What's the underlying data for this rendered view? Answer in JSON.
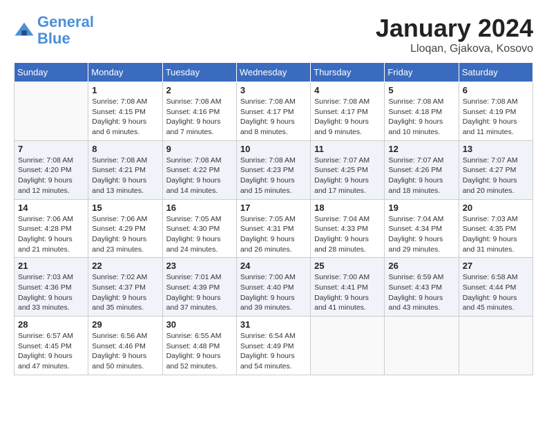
{
  "header": {
    "logo_line1": "General",
    "logo_line2": "Blue",
    "month_year": "January 2024",
    "location": "Lloqan, Gjakova, Kosovo"
  },
  "days_of_week": [
    "Sunday",
    "Monday",
    "Tuesday",
    "Wednesday",
    "Thursday",
    "Friday",
    "Saturday"
  ],
  "weeks": [
    [
      {
        "day": "",
        "sunrise": "",
        "sunset": "",
        "daylight": ""
      },
      {
        "day": "1",
        "sunrise": "Sunrise: 7:08 AM",
        "sunset": "Sunset: 4:15 PM",
        "daylight": "Daylight: 9 hours and 6 minutes."
      },
      {
        "day": "2",
        "sunrise": "Sunrise: 7:08 AM",
        "sunset": "Sunset: 4:16 PM",
        "daylight": "Daylight: 9 hours and 7 minutes."
      },
      {
        "day": "3",
        "sunrise": "Sunrise: 7:08 AM",
        "sunset": "Sunset: 4:17 PM",
        "daylight": "Daylight: 9 hours and 8 minutes."
      },
      {
        "day": "4",
        "sunrise": "Sunrise: 7:08 AM",
        "sunset": "Sunset: 4:17 PM",
        "daylight": "Daylight: 9 hours and 9 minutes."
      },
      {
        "day": "5",
        "sunrise": "Sunrise: 7:08 AM",
        "sunset": "Sunset: 4:18 PM",
        "daylight": "Daylight: 9 hours and 10 minutes."
      },
      {
        "day": "6",
        "sunrise": "Sunrise: 7:08 AM",
        "sunset": "Sunset: 4:19 PM",
        "daylight": "Daylight: 9 hours and 11 minutes."
      }
    ],
    [
      {
        "day": "7",
        "sunrise": "Sunrise: 7:08 AM",
        "sunset": "Sunset: 4:20 PM",
        "daylight": "Daylight: 9 hours and 12 minutes."
      },
      {
        "day": "8",
        "sunrise": "Sunrise: 7:08 AM",
        "sunset": "Sunset: 4:21 PM",
        "daylight": "Daylight: 9 hours and 13 minutes."
      },
      {
        "day": "9",
        "sunrise": "Sunrise: 7:08 AM",
        "sunset": "Sunset: 4:22 PM",
        "daylight": "Daylight: 9 hours and 14 minutes."
      },
      {
        "day": "10",
        "sunrise": "Sunrise: 7:08 AM",
        "sunset": "Sunset: 4:23 PM",
        "daylight": "Daylight: 9 hours and 15 minutes."
      },
      {
        "day": "11",
        "sunrise": "Sunrise: 7:07 AM",
        "sunset": "Sunset: 4:25 PM",
        "daylight": "Daylight: 9 hours and 17 minutes."
      },
      {
        "day": "12",
        "sunrise": "Sunrise: 7:07 AM",
        "sunset": "Sunset: 4:26 PM",
        "daylight": "Daylight: 9 hours and 18 minutes."
      },
      {
        "day": "13",
        "sunrise": "Sunrise: 7:07 AM",
        "sunset": "Sunset: 4:27 PM",
        "daylight": "Daylight: 9 hours and 20 minutes."
      }
    ],
    [
      {
        "day": "14",
        "sunrise": "Sunrise: 7:06 AM",
        "sunset": "Sunset: 4:28 PM",
        "daylight": "Daylight: 9 hours and 21 minutes."
      },
      {
        "day": "15",
        "sunrise": "Sunrise: 7:06 AM",
        "sunset": "Sunset: 4:29 PM",
        "daylight": "Daylight: 9 hours and 23 minutes."
      },
      {
        "day": "16",
        "sunrise": "Sunrise: 7:05 AM",
        "sunset": "Sunset: 4:30 PM",
        "daylight": "Daylight: 9 hours and 24 minutes."
      },
      {
        "day": "17",
        "sunrise": "Sunrise: 7:05 AM",
        "sunset": "Sunset: 4:31 PM",
        "daylight": "Daylight: 9 hours and 26 minutes."
      },
      {
        "day": "18",
        "sunrise": "Sunrise: 7:04 AM",
        "sunset": "Sunset: 4:33 PM",
        "daylight": "Daylight: 9 hours and 28 minutes."
      },
      {
        "day": "19",
        "sunrise": "Sunrise: 7:04 AM",
        "sunset": "Sunset: 4:34 PM",
        "daylight": "Daylight: 9 hours and 29 minutes."
      },
      {
        "day": "20",
        "sunrise": "Sunrise: 7:03 AM",
        "sunset": "Sunset: 4:35 PM",
        "daylight": "Daylight: 9 hours and 31 minutes."
      }
    ],
    [
      {
        "day": "21",
        "sunrise": "Sunrise: 7:03 AM",
        "sunset": "Sunset: 4:36 PM",
        "daylight": "Daylight: 9 hours and 33 minutes."
      },
      {
        "day": "22",
        "sunrise": "Sunrise: 7:02 AM",
        "sunset": "Sunset: 4:37 PM",
        "daylight": "Daylight: 9 hours and 35 minutes."
      },
      {
        "day": "23",
        "sunrise": "Sunrise: 7:01 AM",
        "sunset": "Sunset: 4:39 PM",
        "daylight": "Daylight: 9 hours and 37 minutes."
      },
      {
        "day": "24",
        "sunrise": "Sunrise: 7:00 AM",
        "sunset": "Sunset: 4:40 PM",
        "daylight": "Daylight: 9 hours and 39 minutes."
      },
      {
        "day": "25",
        "sunrise": "Sunrise: 7:00 AM",
        "sunset": "Sunset: 4:41 PM",
        "daylight": "Daylight: 9 hours and 41 minutes."
      },
      {
        "day": "26",
        "sunrise": "Sunrise: 6:59 AM",
        "sunset": "Sunset: 4:43 PM",
        "daylight": "Daylight: 9 hours and 43 minutes."
      },
      {
        "day": "27",
        "sunrise": "Sunrise: 6:58 AM",
        "sunset": "Sunset: 4:44 PM",
        "daylight": "Daylight: 9 hours and 45 minutes."
      }
    ],
    [
      {
        "day": "28",
        "sunrise": "Sunrise: 6:57 AM",
        "sunset": "Sunset: 4:45 PM",
        "daylight": "Daylight: 9 hours and 47 minutes."
      },
      {
        "day": "29",
        "sunrise": "Sunrise: 6:56 AM",
        "sunset": "Sunset: 4:46 PM",
        "daylight": "Daylight: 9 hours and 50 minutes."
      },
      {
        "day": "30",
        "sunrise": "Sunrise: 6:55 AM",
        "sunset": "Sunset: 4:48 PM",
        "daylight": "Daylight: 9 hours and 52 minutes."
      },
      {
        "day": "31",
        "sunrise": "Sunrise: 6:54 AM",
        "sunset": "Sunset: 4:49 PM",
        "daylight": "Daylight: 9 hours and 54 minutes."
      },
      {
        "day": "",
        "sunrise": "",
        "sunset": "",
        "daylight": ""
      },
      {
        "day": "",
        "sunrise": "",
        "sunset": "",
        "daylight": ""
      },
      {
        "day": "",
        "sunrise": "",
        "sunset": "",
        "daylight": ""
      }
    ]
  ]
}
